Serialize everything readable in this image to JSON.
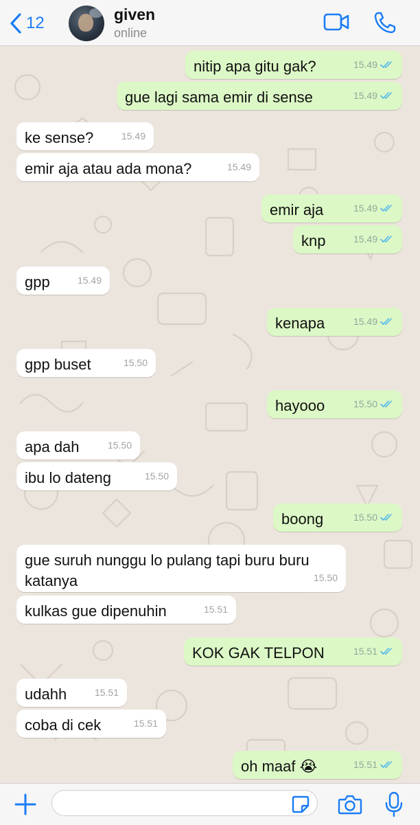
{
  "header": {
    "back_count": "12",
    "contact_name": "given",
    "status": "online"
  },
  "colors": {
    "accent": "#1a7cf5",
    "outgoing_bubble": "#dcf8c6",
    "incoming_bubble": "#ffffff",
    "chat_background": "#ece5dd",
    "read_ticks": "#4fb6ec"
  },
  "messages": [
    {
      "dir": "out",
      "text": "nitip apa gitu gak?",
      "time": "15.49",
      "status": "read"
    },
    {
      "dir": "out",
      "text": "gue lagi sama emir di sense",
      "time": "15.49",
      "status": "read"
    },
    {
      "dir": "in",
      "text": "ke sense?",
      "time": "15.49"
    },
    {
      "dir": "in",
      "text": "emir aja atau ada mona?",
      "time": "15.49"
    },
    {
      "dir": "out",
      "text": "emir aja",
      "time": "15.49",
      "status": "read"
    },
    {
      "dir": "out",
      "text": "knp",
      "time": "15.49",
      "status": "read"
    },
    {
      "dir": "in",
      "text": "gpp",
      "time": "15.49"
    },
    {
      "dir": "out",
      "text": "kenapa",
      "time": "15.49",
      "status": "read"
    },
    {
      "dir": "in",
      "text": "gpp buset",
      "time": "15.50"
    },
    {
      "dir": "out",
      "text": "hayooo",
      "time": "15.50",
      "status": "read"
    },
    {
      "dir": "in",
      "text": "apa dah",
      "time": "15.50"
    },
    {
      "dir": "in",
      "text": "ibu lo dateng",
      "time": "15.50"
    },
    {
      "dir": "out",
      "text": "boong",
      "time": "15.50",
      "status": "read"
    },
    {
      "dir": "in",
      "text": "gue suruh nunggu lo pulang tapi buru buru katanya",
      "time": "15.50"
    },
    {
      "dir": "in",
      "text": "kulkas gue dipenuhin",
      "time": "15.51"
    },
    {
      "dir": "out",
      "text": "KOK GAK TELPON",
      "time": "15.51",
      "status": "read"
    },
    {
      "dir": "in",
      "text": "udahh",
      "time": "15.51"
    },
    {
      "dir": "in",
      "text": "coba di cek",
      "time": "15.51"
    },
    {
      "dir": "out",
      "text": "oh maaf 😭",
      "time": "15.51",
      "status": "read"
    }
  ],
  "input": {
    "placeholder": ""
  },
  "icons": {
    "back": "chevron-left-icon",
    "video": "video-call-icon",
    "phone": "phone-call-icon",
    "plus": "plus-icon",
    "sticker": "sticker-icon",
    "camera": "camera-icon",
    "mic": "microphone-icon"
  }
}
